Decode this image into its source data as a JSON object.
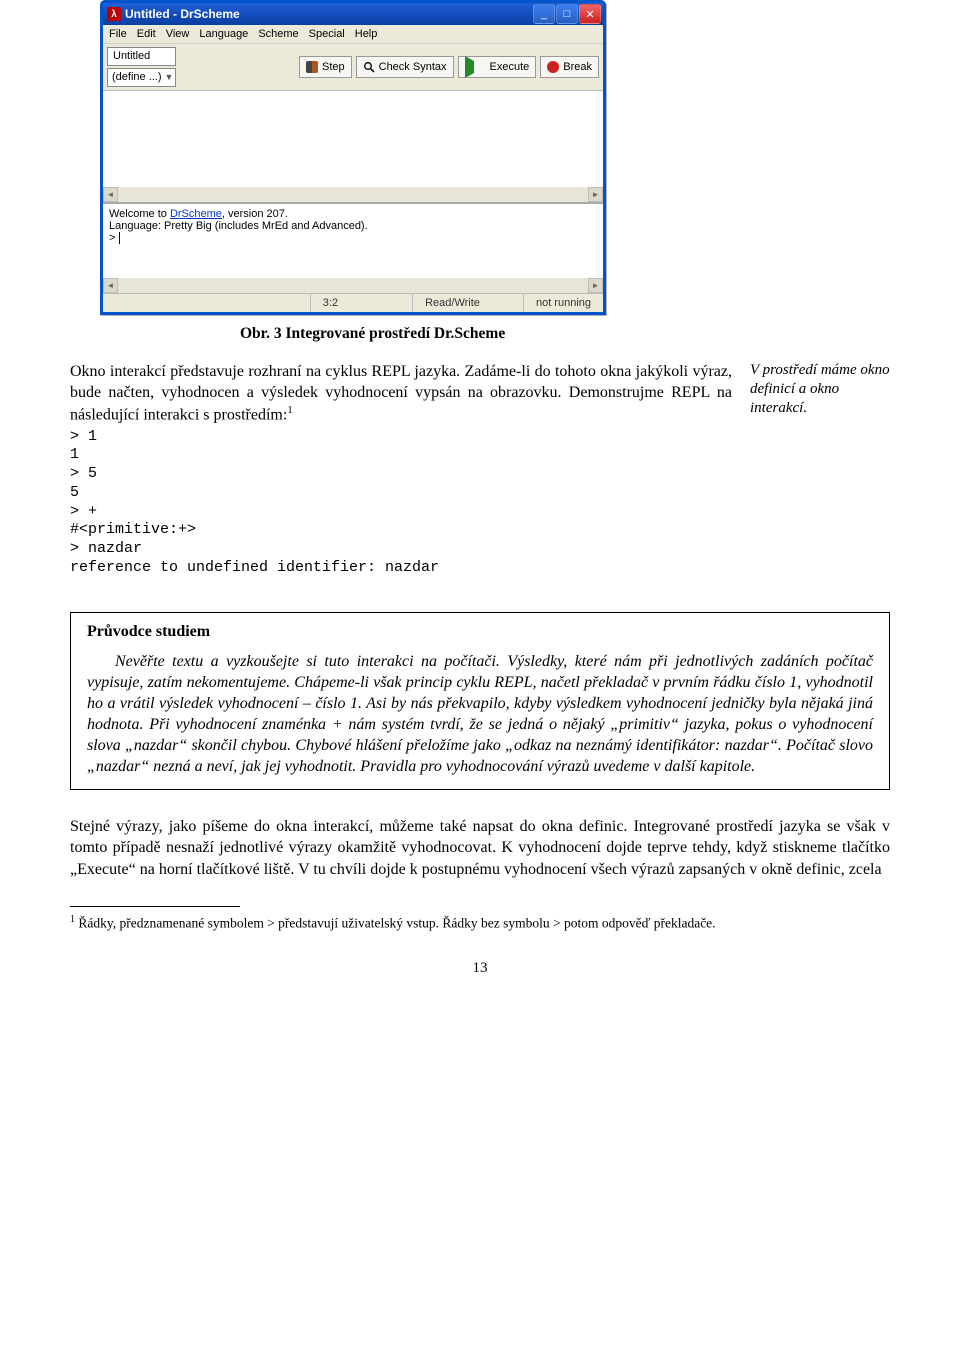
{
  "window": {
    "title": "Untitled - DrScheme",
    "appicon_glyph": "λ",
    "menu": [
      "File",
      "Edit",
      "View",
      "Language",
      "Scheme",
      "Special",
      "Help"
    ],
    "tab_label": "Untitled",
    "define_label": "(define ...)",
    "toolbar": {
      "step": "Step",
      "check": "Check Syntax",
      "execute": "Execute",
      "break": "Break"
    },
    "interact": {
      "welcome_prefix": "Welcome to ",
      "welcome_link": "DrScheme",
      "welcome_suffix": ", version 207.",
      "lang_line": "Language: Pretty Big (includes MrEd and Advanced).",
      "prompt": ">"
    },
    "status": {
      "pos": "3:2",
      "mode": "Read/Write",
      "run": "not running"
    }
  },
  "caption": "Obr. 3 Integrované prostředí Dr.Scheme",
  "body_para": "Okno interakcí představuje rozhraní na cyklus REPL jazyka. Zadáme-li do tohoto okna jakýkoli výraz, bude načten, vyhodnocen a výsledek vyhodnocení vypsán na obrazovku. Demonstrujme REPL na následující interakci s prostředím:",
  "margin_note": "V prostředí máme okno definicí a okno interakcí.",
  "code": "> 1\n1\n> 5\n5\n> +\n#<primitive:+>\n> nazdar\nreference to undefined identifier: nazdar",
  "guide": {
    "title": "Průvodce studiem",
    "body": "Nevěřte textu a vyzkoušejte si tuto interakci na počítači. Výsledky, které nám při jednotlivých zadáních počítač vypisuje, zatím nekomentujeme. Chápeme-li však princip cyklu REPL, načetl překladač v prvním řádku číslo 1, vyhodnotil ho a vrátil výsledek vyhodnocení – číslo 1. Asi by nás překvapilo, kdyby výsledkem vyhodnocení jedničky byla nějaká jiná hodnota. Při vyhodnocení znaménka + nám systém tvrdí, že se jedná o nějaký „primitiv“ jazyka, pokus o vyhodnocení slova „nazdar“ skončil chybou. Chybové hlášení přeložíme jako „odkaz na neznámý identifikátor: nazdar“. Počítač slovo „nazdar“ nezná a neví, jak jej vyhodnotit. Pravidla pro vyhodnocování výrazů uvedeme v další kapitole."
  },
  "para2": "Stejné výrazy, jako píšeme do okna interakcí, můžeme také napsat do okna definic. Integrované prostředí jazyka se však v tomto případě nesnaží jednotlivé výrazy okamžitě vyhodnocovat. K vyhodnocení dojde teprve tehdy, když stiskneme tlačítko „Execute“ na horní tlačítkové liště. V tu chvíli dojde k postupnému vyhodnocení všech výrazů zapsaných v okně definic, zcela",
  "footnote": "Řádky, předznamenané symbolem > představují uživatelský vstup. Řádky bez symbolu > potom odpověď překladače.",
  "footnote_marker": "1",
  "page_number": "13"
}
